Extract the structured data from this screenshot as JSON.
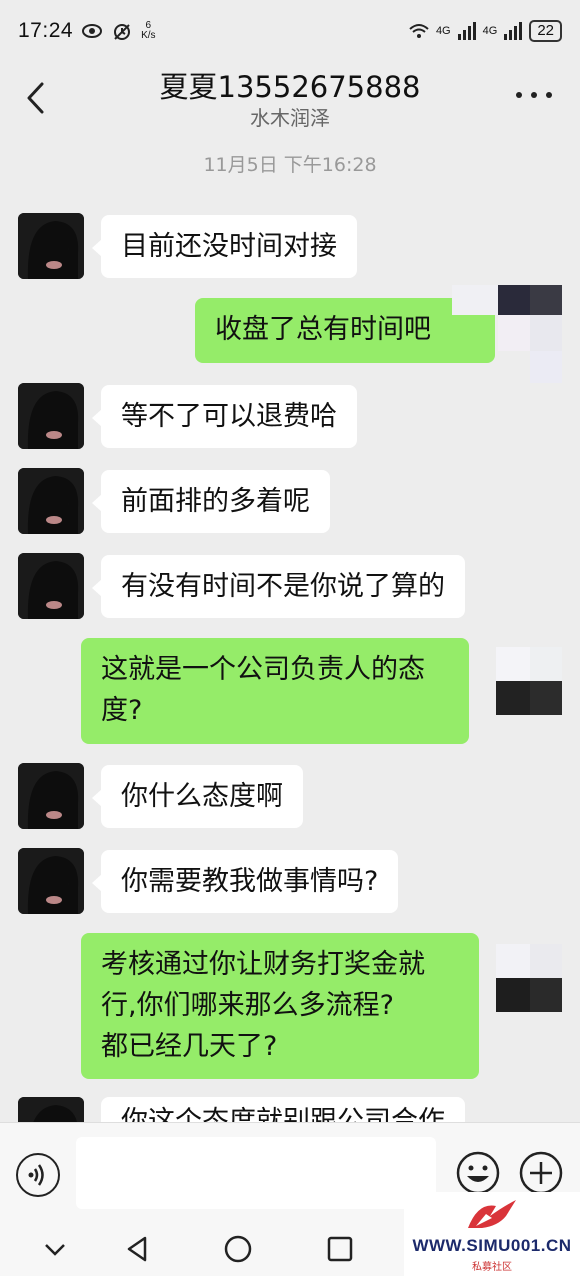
{
  "status_bar": {
    "time": "17:24",
    "speed_value": "6",
    "speed_unit": "K/s",
    "signal_label_1": "4G",
    "signal_label_2": "4G",
    "battery": "22"
  },
  "header": {
    "title": "夏夏13552675888",
    "subtitle": "水木润泽"
  },
  "timestamp": "11月5日 下午16:28",
  "messages": [
    {
      "side": "left",
      "lines": [
        "目前还没时间对接"
      ]
    },
    {
      "side": "right",
      "lines": [
        "收盘了总有时间吧"
      ]
    },
    {
      "side": "left",
      "lines": [
        "等不了可以退费哈"
      ]
    },
    {
      "side": "left",
      "lines": [
        "前面排的多着呢"
      ]
    },
    {
      "side": "left",
      "lines": [
        "有没有时间不是你说了算的"
      ]
    },
    {
      "side": "right",
      "lines": [
        "这就是一个公司负责人的态",
        "度?"
      ]
    },
    {
      "side": "left",
      "lines": [
        "你什么态度啊"
      ]
    },
    {
      "side": "left",
      "lines": [
        "你需要教我做事情吗?"
      ]
    },
    {
      "side": "right",
      "lines": [
        "考核通过你让财务打奖金就",
        "行,你们哪来那么多流程?",
        "都已经几天了?"
      ]
    },
    {
      "side": "left",
      "lines": [
        "你这个态度就别跟公司合作"
      ]
    }
  ],
  "input": {
    "placeholder": ""
  },
  "icons": {
    "back": "chevron-left-icon",
    "more": "more-dots-icon",
    "voice": "voice-icon",
    "emoji": "emoji-icon",
    "plus": "plus-icon"
  },
  "watermark": {
    "text": "WWW.SIMU001.CN",
    "sub": "私募社区"
  },
  "colors": {
    "sent_bubble": "#95ec69",
    "received_bubble": "#ffffff",
    "background": "#ededed"
  }
}
